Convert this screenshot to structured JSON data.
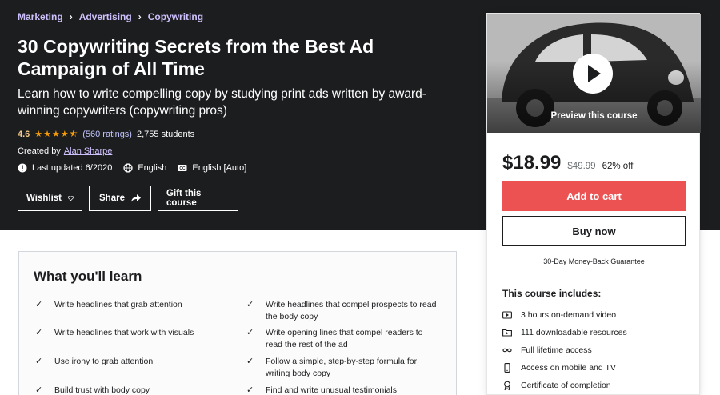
{
  "breadcrumb": [
    "Marketing",
    "Advertising",
    "Copywriting"
  ],
  "course": {
    "title": "30 Copywriting Secrets from the Best Ad Campaign of All Time",
    "subtitle": "Learn how to write compelling copy by studying print ads written by award-winning copywriters (copywriting pros)",
    "rating": "4.6",
    "stars": 4.5,
    "ratings_count": "(560 ratings)",
    "students": "2,755 students",
    "created_by_label": "Created by",
    "author": "Alan Sharpe",
    "last_updated": "Last updated 6/2020",
    "language": "English",
    "captions": "English [Auto]"
  },
  "actions": {
    "wishlist": "Wishlist",
    "share": "Share",
    "gift": "Gift this course"
  },
  "card": {
    "preview_label": "Preview this course",
    "price": "$18.99",
    "old_price": "$49.99",
    "discount": "62% off",
    "add_to_cart": "Add to cart",
    "buy_now": "Buy now",
    "guarantee": "30-Day Money-Back Guarantee",
    "includes_title": "This course includes:",
    "includes": [
      {
        "icon": "video-icon",
        "label": "3 hours on-demand video"
      },
      {
        "icon": "folder-icon",
        "label": "111 downloadable resources"
      },
      {
        "icon": "infinity-icon",
        "label": "Full lifetime access"
      },
      {
        "icon": "mobile-icon",
        "label": "Access on mobile and TV"
      },
      {
        "icon": "certificate-icon",
        "label": "Certificate of completion"
      }
    ]
  },
  "learn": {
    "title": "What you'll learn",
    "items": [
      "Write headlines that grab attention",
      "Write headlines that compel prospects to read the body copy",
      "Write headlines that work with visuals",
      "Write opening lines that compel readers to read the rest of the ad",
      "Use irony to grab attention",
      "Follow a simple, step-by-step formula for writing body copy",
      "Build trust with body copy",
      "Find and write unusual testimonials"
    ]
  },
  "colors": {
    "hero_bg": "#1c1d1f",
    "breadcrumb": "#cec0fc",
    "rating": "#f3ca8c",
    "star": "#f69c08",
    "cart_button": "#ec5252"
  }
}
